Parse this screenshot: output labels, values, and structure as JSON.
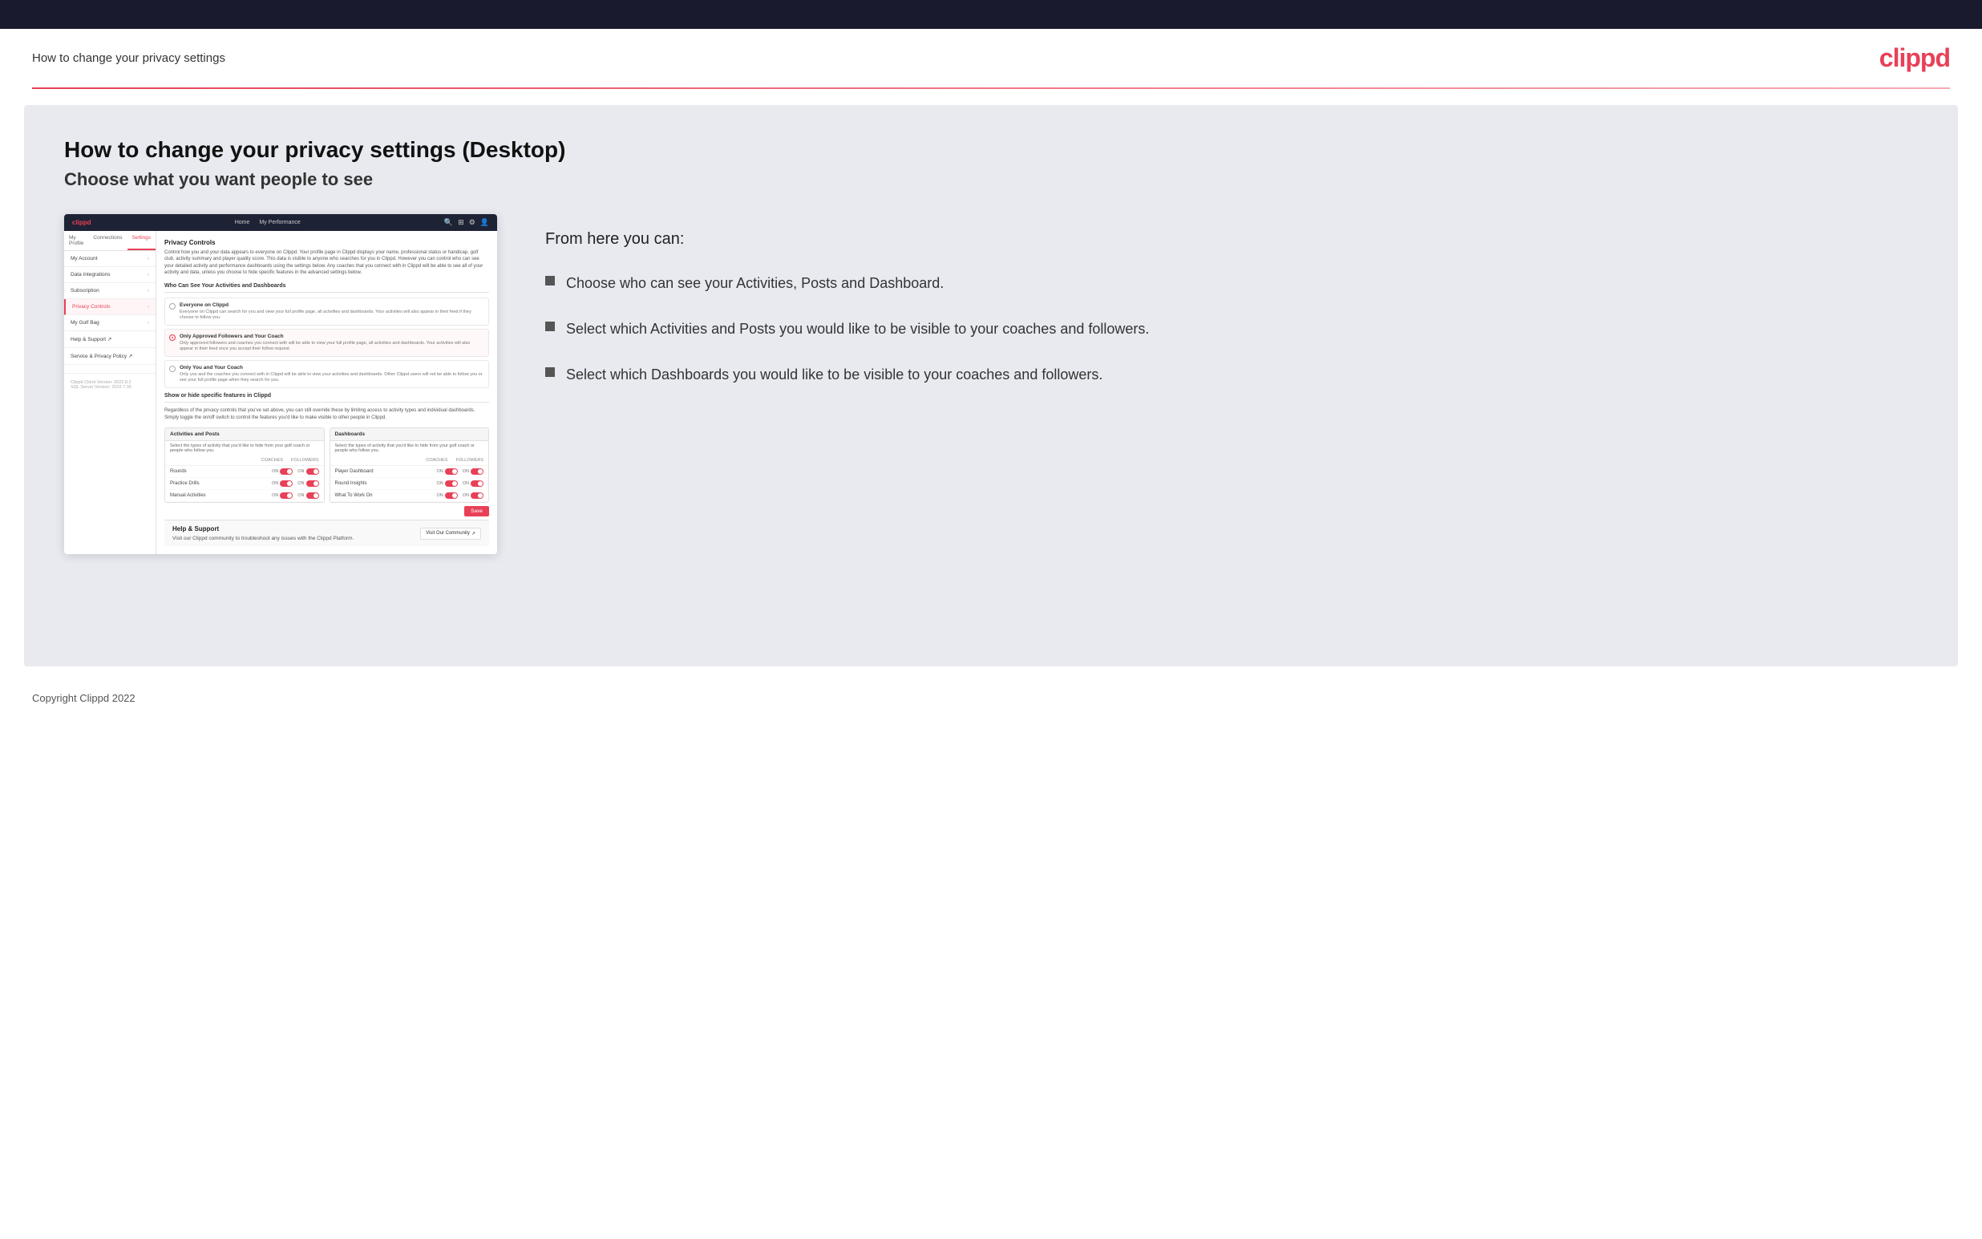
{
  "topbar": {},
  "header": {
    "title": "How to change your privacy settings",
    "logo": "clippd"
  },
  "main": {
    "heading": "How to change your privacy settings (Desktop)",
    "subheading": "Choose what you want people to see",
    "from_here": "From here you can:",
    "bullets": [
      "Choose who can see your Activities, Posts and Dashboard.",
      "Select which Activities and Posts you would like to be visible to your coaches and followers.",
      "Select which Dashboards you would like to be visible to your coaches and followers."
    ]
  },
  "mockup": {
    "logo": "clippd",
    "nav": [
      "Home",
      "My Performance"
    ],
    "sidebar_tabs": [
      "My Profile",
      "Connections",
      "Settings"
    ],
    "sidebar_items": [
      {
        "label": "My Account",
        "active": false
      },
      {
        "label": "Data Integrations",
        "active": false
      },
      {
        "label": "Subscription",
        "active": false
      },
      {
        "label": "Privacy Controls",
        "active": true
      },
      {
        "label": "My Golf Bag",
        "active": false
      },
      {
        "label": "Help & Support",
        "active": false
      },
      {
        "label": "Service & Privacy Policy",
        "active": false
      }
    ],
    "section_title": "Privacy Controls",
    "section_desc": "Control how you and your data appears to everyone on Clippd. Your profile page in Clippd displays your name, professional status or handicap, golf club, activity summary and player quality score. This data is visible to anyone who searches for you in Clippd. However you can control who can see your detailed activity and performance dashboards using the settings below. Any coaches that you connect with in Clippd will be able to see all of your activity and data, unless you choose to hide specific features in the advanced settings below.",
    "who_section": "Who Can See Your Activities and Dashboards",
    "radio_options": [
      {
        "label": "Everyone on Clippd",
        "desc": "Everyone on Clippd can search for you and view your full profile page, all activities and dashboards. Your activities will also appear in their feed if they choose to follow you.",
        "selected": false
      },
      {
        "label": "Only Approved Followers and Your Coach",
        "desc": "Only approved followers and coaches you connect with will be able to view your full profile page, all activities and dashboards. Your activities will also appear in their feed once you accept their follow request.",
        "selected": true
      },
      {
        "label": "Only You and Your Coach",
        "desc": "Only you and the coaches you connect with in Clippd will be able to view your activities and dashboards. Other Clippd users will not be able to follow you or see your full profile page when they search for you.",
        "selected": false
      }
    ],
    "show_hide_title": "Show or hide specific features in Clippd",
    "show_hide_desc": "Regardless of the privacy controls that you've set above, you can still override these by limiting access to activity types and individual dashboards. Simply toggle the on/off switch to control the features you'd like to make visible to other people in Clippd.",
    "activities_panel": {
      "title": "Activities and Posts",
      "desc": "Select the types of activity that you'd like to hide from your golf coach or people who follow you.",
      "cols": [
        "COACHES",
        "FOLLOWERS"
      ],
      "rows": [
        {
          "label": "Rounds",
          "coaches_on": true,
          "followers_on": true
        },
        {
          "label": "Practice Drills",
          "coaches_on": true,
          "followers_on": true
        },
        {
          "label": "Manual Activities",
          "coaches_on": true,
          "followers_on": true
        }
      ]
    },
    "dashboards_panel": {
      "title": "Dashboards",
      "desc": "Select the types of activity that you'd like to hide from your golf coach or people who follow you.",
      "cols": [
        "COACHES",
        "FOLLOWERS"
      ],
      "rows": [
        {
          "label": "Player Dashboard",
          "coaches_on": true,
          "followers_on": true
        },
        {
          "label": "Round Insights",
          "coaches_on": true,
          "followers_on": true
        },
        {
          "label": "What To Work On",
          "coaches_on": true,
          "followers_on": true
        }
      ]
    },
    "save_label": "Save",
    "help_section_title": "Help & Support",
    "help_desc": "Visit our Clippd community to troubleshoot any issues with the Clippd Platform.",
    "help_btn": "Visit Our Community",
    "version": "Clippd Client Version: 2022.8.2\nSQL Server Version: 2022.7.35"
  },
  "footer": {
    "copyright": "Copyright Clippd 2022"
  }
}
